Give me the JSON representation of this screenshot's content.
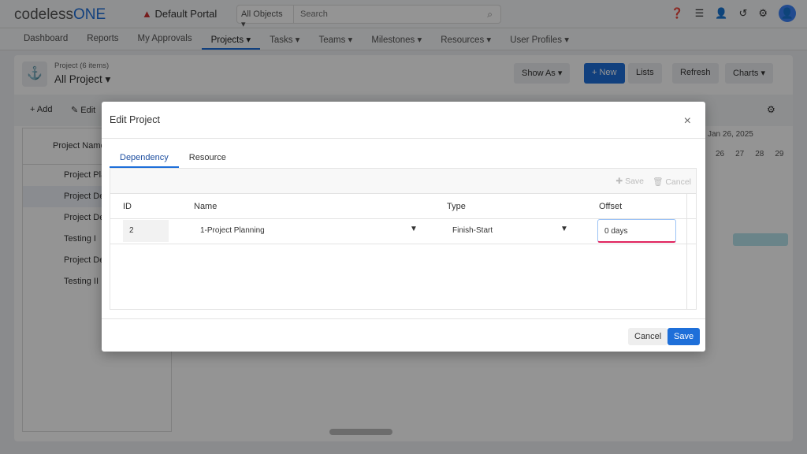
{
  "header": {
    "logo_prefix": "codeless",
    "logo_suffix": "ONE",
    "portal": "Default Portal",
    "search_scope": "All Objects",
    "search_placeholder": "Search"
  },
  "nav": [
    "Dashboard",
    "Reports",
    "My Approvals",
    "Projects ▾",
    "Tasks ▾",
    "Teams ▾",
    "Milestones ▾",
    "Resources ▾",
    "User Profiles ▾"
  ],
  "page": {
    "subtitle": "Project (6 items)",
    "title": "All Project ▾",
    "show_as": "Show As ▾",
    "new": "+ New",
    "lists": "Lists",
    "refresh": "Refresh",
    "charts": "Charts ▾",
    "add": "+ Add",
    "edit": "Edit",
    "col_name": "Project Name",
    "rows": [
      "Project Pla",
      "Project De",
      "Project Dev",
      "Testing I",
      "Project Dev",
      "Testing II"
    ],
    "gantt_week": "Jan 26, 2025",
    "gantt_days": [
      "26",
      "27",
      "28",
      "29"
    ]
  },
  "modal": {
    "title": "Edit Project",
    "tabs": [
      "Dependency",
      "Resource"
    ],
    "toolbar_save": "Save",
    "toolbar_cancel": "Cancel",
    "columns": [
      "ID",
      "Name",
      "Type",
      "Offset"
    ],
    "row": {
      "id": "2",
      "name": "1-Project Planning",
      "type": "Finish-Start",
      "offset": "0 days"
    },
    "cancel": "Cancel",
    "save": "Save"
  }
}
